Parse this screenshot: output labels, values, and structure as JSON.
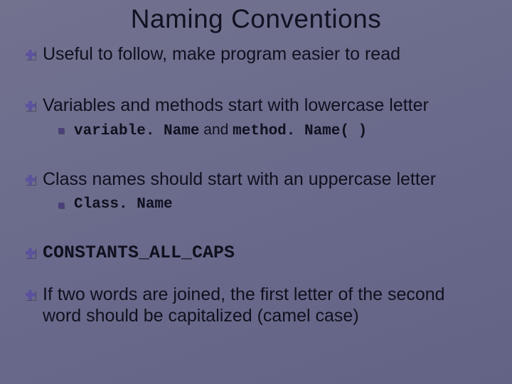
{
  "title": "Naming Conventions",
  "b1_useful": "Useful to follow, make program easier to read",
  "b1_vars": "Variables and methods start with lowercase letter",
  "b2_vars_code1": "variable. Name",
  "b2_vars_mid": " and ",
  "b2_vars_code2": "method. Name( )",
  "b1_class": "Class names should start with an uppercase letter",
  "b2_class_code": "Class. Name",
  "b1_const_code": "CONSTANTS_ALL_CAPS",
  "b1_camel": "If two words are joined, the first letter of the second word should be capitalized (camel case)"
}
